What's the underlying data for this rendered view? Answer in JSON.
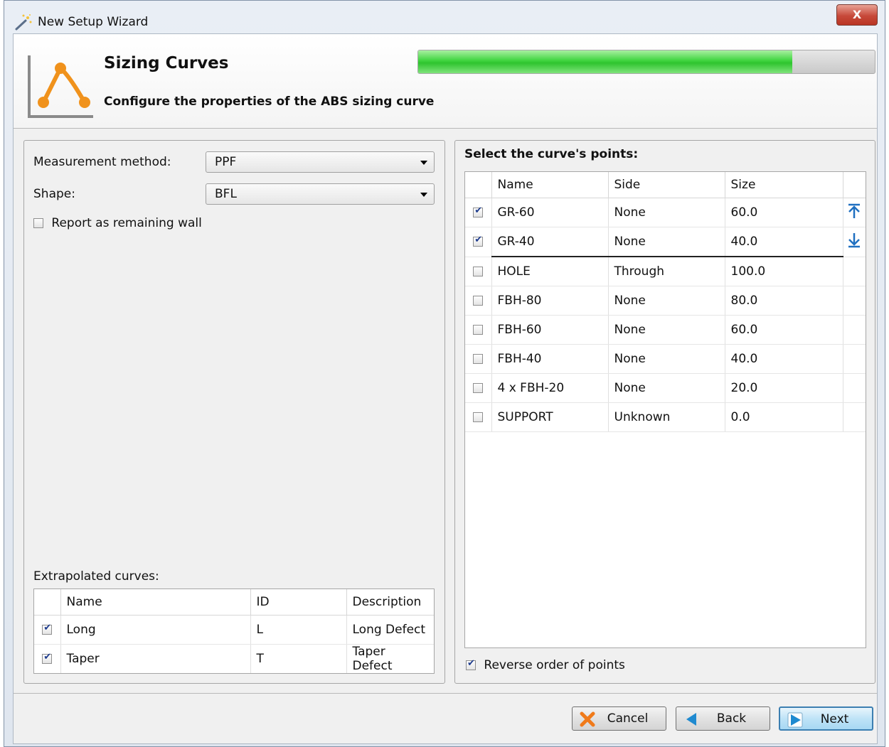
{
  "window": {
    "title": "New Setup Wizard",
    "close_label": "X"
  },
  "header": {
    "title": "Sizing Curves",
    "subtitle": "Configure the properties of the ABS sizing curve",
    "progress": 0.82,
    "progress_color": "#3ed43e"
  },
  "left": {
    "measurement_label": "Measurement method:",
    "measurement_value": "PPF",
    "shape_label": "Shape:",
    "shape_value": "BFL",
    "report_remaining_label": "Report as remaining wall",
    "report_remaining_checked": false,
    "extrapolated_label": "Extrapolated curves:",
    "extrapolated": {
      "columns": [
        "Name",
        "ID",
        "Description"
      ],
      "rows": [
        {
          "checked": true,
          "name": "Long",
          "id": "L",
          "description": "Long Defect"
        },
        {
          "checked": true,
          "name": "Taper",
          "id": "T",
          "description": "Taper Defect"
        }
      ]
    }
  },
  "right": {
    "points_label": "Select the curve's points:",
    "points": {
      "columns": [
        "Name",
        "Side",
        "Size"
      ],
      "rows": [
        {
          "checked": true,
          "name": "GR-60",
          "side": "None",
          "size": "60.0"
        },
        {
          "checked": true,
          "name": "GR-40",
          "side": "None",
          "size": "40.0"
        },
        {
          "checked": false,
          "name": "HOLE",
          "side": "Through",
          "size": "100.0"
        },
        {
          "checked": false,
          "name": "FBH-80",
          "side": "None",
          "size": "80.0"
        },
        {
          "checked": false,
          "name": "FBH-60",
          "side": "None",
          "size": "60.0"
        },
        {
          "checked": false,
          "name": "FBH-40",
          "side": "None",
          "size": "40.0"
        },
        {
          "checked": false,
          "name": "4 x FBH-20",
          "side": "None",
          "size": "20.0"
        },
        {
          "checked": false,
          "name": "SUPPORT",
          "side": "Unknown",
          "size": "0.0"
        }
      ]
    },
    "reverse_label": "Reverse order of points",
    "reverse_checked": true
  },
  "buttons": {
    "cancel": "Cancel",
    "back": "Back",
    "next": "Next"
  },
  "icons": {
    "title": "wizard-wand-icon",
    "header": "sizing-curve-icon",
    "move_up": "move-to-top-icon",
    "move_down": "move-to-bottom-icon",
    "cancel": "cancel-x-icon",
    "back": "back-arrow-icon",
    "next": "next-arrow-icon"
  },
  "colors": {
    "accent_orange": "#f0921c",
    "arrow_blue": "#1f6fc0",
    "cancel_orange": "#f07a1a"
  }
}
